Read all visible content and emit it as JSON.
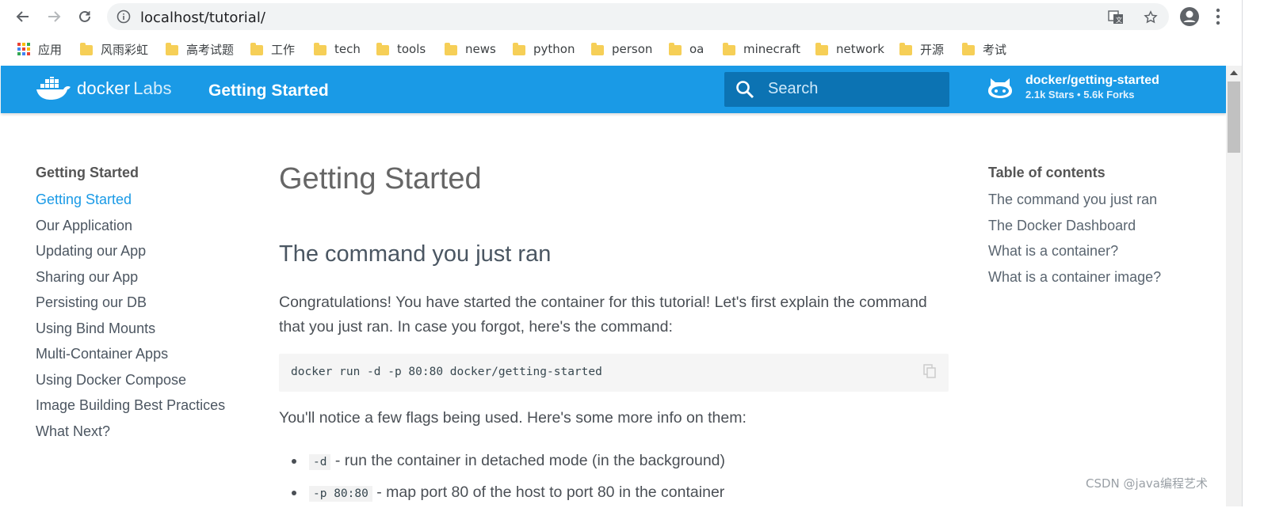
{
  "browser": {
    "url": "localhost/tutorial/",
    "bookmarks": [
      "应用",
      "风雨彩虹",
      "高考试题",
      "工作",
      "tech",
      "tools",
      "news",
      "python",
      "person",
      "oa",
      "minecraft",
      "network",
      "开源",
      "考试"
    ]
  },
  "header": {
    "brand": "docker",
    "brand_suffix": "Labs",
    "title": "Getting Started",
    "search_placeholder": "Search",
    "repo_name": "docker/getting-started",
    "repo_stats": "2.1k Stars • 5.6k Forks",
    "color": "#1a9ae6"
  },
  "left_nav": {
    "title": "Getting Started",
    "items": [
      "Getting Started",
      "Our Application",
      "Updating our App",
      "Sharing our App",
      "Persisting our DB",
      "Using Bind Mounts",
      "Multi-Container Apps",
      "Using Docker Compose",
      "Image Building Best Practices",
      "What Next?"
    ],
    "active_index": 0
  },
  "main": {
    "h1": "Getting Started",
    "h2": "The command you just ran",
    "para1": "Congratulations! You have started the container for this tutorial! Let's first explain the command that you just ran. In case you forgot, here's the command:",
    "code": "docker run -d -p 80:80 docker/getting-started",
    "para2": "You'll notice a few flags being used. Here's some more info on them:",
    "flags": [
      {
        "code": "-d",
        "text": " - run the container in detached mode (in the background)"
      },
      {
        "code": "-p 80:80",
        "text": " - map port 80 of the host to port 80 in the container"
      }
    ]
  },
  "toc": {
    "title": "Table of contents",
    "items": [
      "The command you just ran",
      "The Docker Dashboard",
      "What is a container?",
      "What is a container image?"
    ]
  },
  "watermark": "CSDN @java编程艺术"
}
